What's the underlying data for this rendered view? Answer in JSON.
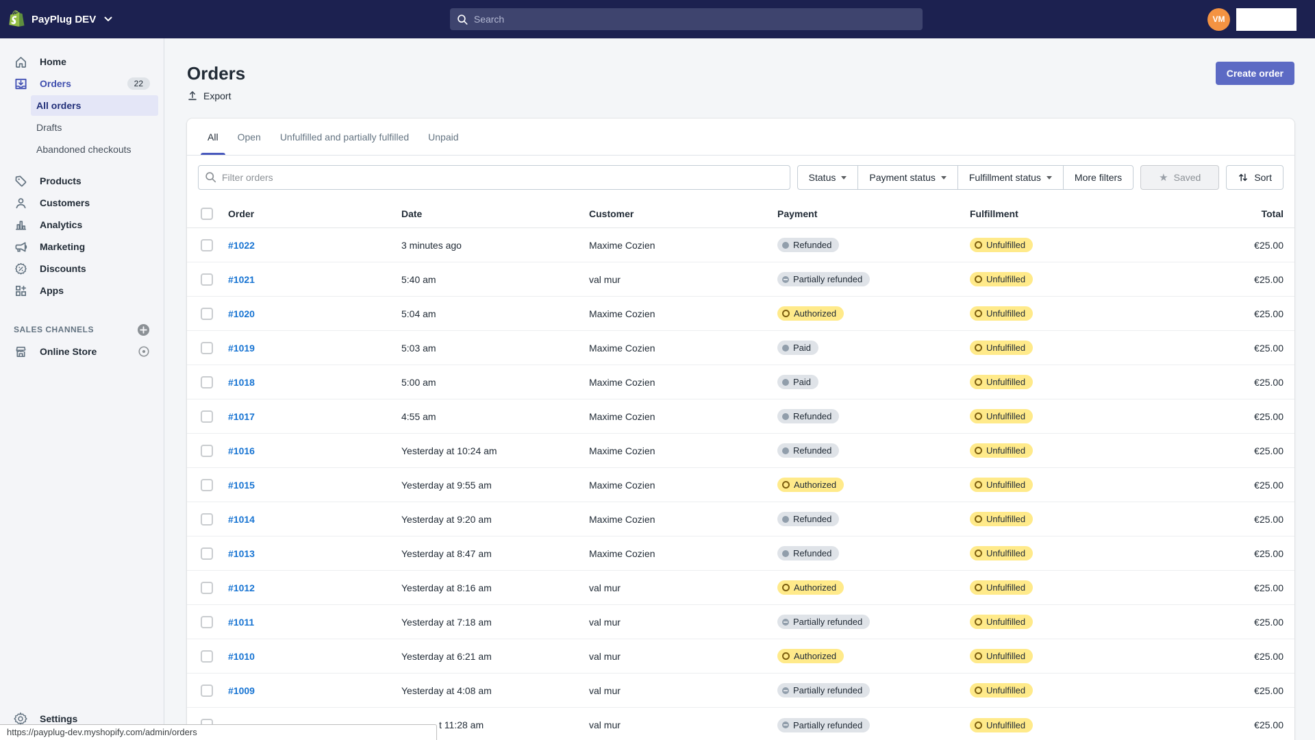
{
  "topbar": {
    "store_name": "PayPlug DEV",
    "search_placeholder": "Search",
    "avatar_initials": "VM"
  },
  "sidebar": {
    "home": "Home",
    "orders": "Orders",
    "orders_badge": "22",
    "all_orders": "All orders",
    "drafts": "Drafts",
    "abandoned": "Abandoned checkouts",
    "products": "Products",
    "customers": "Customers",
    "analytics": "Analytics",
    "marketing": "Marketing",
    "discounts": "Discounts",
    "apps": "Apps",
    "sales_channels": "SALES CHANNELS",
    "online_store": "Online Store",
    "settings": "Settings"
  },
  "header": {
    "title": "Orders",
    "export_label": "Export",
    "create_order_label": "Create order"
  },
  "tabs": [
    "All",
    "Open",
    "Unfulfilled and partially fulfilled",
    "Unpaid"
  ],
  "tabs_selected": 0,
  "filters": {
    "search_placeholder": "Filter orders",
    "buttons": [
      {
        "label": "Status",
        "caret": true
      },
      {
        "label": "Payment status",
        "caret": true
      },
      {
        "label": "Fulfillment status",
        "caret": true
      },
      {
        "label": "More filters",
        "caret": false
      }
    ],
    "saved_label": "Saved",
    "sort_label": "Sort"
  },
  "table": {
    "columns": [
      "Order",
      "Date",
      "Customer",
      "Payment",
      "Fulfillment",
      "Total"
    ],
    "rows": [
      {
        "order": "#1022",
        "date": "3 minutes ago",
        "customer": "Maxime Cozien",
        "payment": {
          "label": "Refunded",
          "tone": "gray",
          "dot": "filled"
        },
        "fulfillment": {
          "label": "Unfulfilled",
          "tone": "yellow",
          "dot": "open"
        },
        "total": "€25.00"
      },
      {
        "order": "#1021",
        "date": "5:40 am",
        "customer": "val mur",
        "payment": {
          "label": "Partially refunded",
          "tone": "gray",
          "dot": "partial"
        },
        "fulfillment": {
          "label": "Unfulfilled",
          "tone": "yellow",
          "dot": "open"
        },
        "total": "€25.00"
      },
      {
        "order": "#1020",
        "date": "5:04 am",
        "customer": "Maxime Cozien",
        "payment": {
          "label": "Authorized",
          "tone": "yellow",
          "dot": "open"
        },
        "fulfillment": {
          "label": "Unfulfilled",
          "tone": "yellow",
          "dot": "open"
        },
        "total": "€25.00"
      },
      {
        "order": "#1019",
        "date": "5:03 am",
        "customer": "Maxime Cozien",
        "payment": {
          "label": "Paid",
          "tone": "gray",
          "dot": "filled"
        },
        "fulfillment": {
          "label": "Unfulfilled",
          "tone": "yellow",
          "dot": "open"
        },
        "total": "€25.00"
      },
      {
        "order": "#1018",
        "date": "5:00 am",
        "customer": "Maxime Cozien",
        "payment": {
          "label": "Paid",
          "tone": "gray",
          "dot": "filled"
        },
        "fulfillment": {
          "label": "Unfulfilled",
          "tone": "yellow",
          "dot": "open"
        },
        "total": "€25.00"
      },
      {
        "order": "#1017",
        "date": "4:55 am",
        "customer": "Maxime Cozien",
        "payment": {
          "label": "Refunded",
          "tone": "gray",
          "dot": "filled"
        },
        "fulfillment": {
          "label": "Unfulfilled",
          "tone": "yellow",
          "dot": "open"
        },
        "total": "€25.00"
      },
      {
        "order": "#1016",
        "date": "Yesterday at 10:24 am",
        "customer": "Maxime Cozien",
        "payment": {
          "label": "Refunded",
          "tone": "gray",
          "dot": "filled"
        },
        "fulfillment": {
          "label": "Unfulfilled",
          "tone": "yellow",
          "dot": "open"
        },
        "total": "€25.00"
      },
      {
        "order": "#1015",
        "date": "Yesterday at 9:55 am",
        "customer": "Maxime Cozien",
        "payment": {
          "label": "Authorized",
          "tone": "yellow",
          "dot": "open"
        },
        "fulfillment": {
          "label": "Unfulfilled",
          "tone": "yellow",
          "dot": "open"
        },
        "total": "€25.00"
      },
      {
        "order": "#1014",
        "date": "Yesterday at 9:20 am",
        "customer": "Maxime Cozien",
        "payment": {
          "label": "Refunded",
          "tone": "gray",
          "dot": "filled"
        },
        "fulfillment": {
          "label": "Unfulfilled",
          "tone": "yellow",
          "dot": "open"
        },
        "total": "€25.00"
      },
      {
        "order": "#1013",
        "date": "Yesterday at 8:47 am",
        "customer": "Maxime Cozien",
        "payment": {
          "label": "Refunded",
          "tone": "gray",
          "dot": "filled"
        },
        "fulfillment": {
          "label": "Unfulfilled",
          "tone": "yellow",
          "dot": "open"
        },
        "total": "€25.00"
      },
      {
        "order": "#1012",
        "date": "Yesterday at 8:16 am",
        "customer": "val mur",
        "payment": {
          "label": "Authorized",
          "tone": "yellow",
          "dot": "open"
        },
        "fulfillment": {
          "label": "Unfulfilled",
          "tone": "yellow",
          "dot": "open"
        },
        "total": "€25.00"
      },
      {
        "order": "#1011",
        "date": "Yesterday at 7:18 am",
        "customer": "val mur",
        "payment": {
          "label": "Partially refunded",
          "tone": "gray",
          "dot": "partial"
        },
        "fulfillment": {
          "label": "Unfulfilled",
          "tone": "yellow",
          "dot": "open"
        },
        "total": "€25.00"
      },
      {
        "order": "#1010",
        "date": "Yesterday at 6:21 am",
        "customer": "val mur",
        "payment": {
          "label": "Authorized",
          "tone": "yellow",
          "dot": "open"
        },
        "fulfillment": {
          "label": "Unfulfilled",
          "tone": "yellow",
          "dot": "open"
        },
        "total": "€25.00"
      },
      {
        "order": "#1009",
        "date": "Yesterday at 4:08 am",
        "customer": "val mur",
        "payment": {
          "label": "Partially refunded",
          "tone": "gray",
          "dot": "partial"
        },
        "fulfillment": {
          "label": "Unfulfilled",
          "tone": "yellow",
          "dot": "open"
        },
        "total": "€25.00"
      },
      {
        "order": "",
        "date": "t 11:28 am",
        "customer": "val mur",
        "payment": {
          "label": "Partially refunded",
          "tone": "gray",
          "dot": "partial"
        },
        "fulfillment": {
          "label": "Unfulfilled",
          "tone": "yellow",
          "dot": "open"
        },
        "total": "€25.00",
        "partial": true
      }
    ]
  },
  "statusbar_url": "https://payplug-dev.myshopify.com/admin/orders",
  "colors": {
    "topbar": "#1c2150",
    "accent_indigo": "#5c6ac4",
    "avatar_orange": "#f49342",
    "logo_green": "#95bf47",
    "badge_yellow": "#ffea8a",
    "badge_gray": "#dfe3e8",
    "link_blue": "#1673d2",
    "page_background": "#f4f6f8"
  }
}
